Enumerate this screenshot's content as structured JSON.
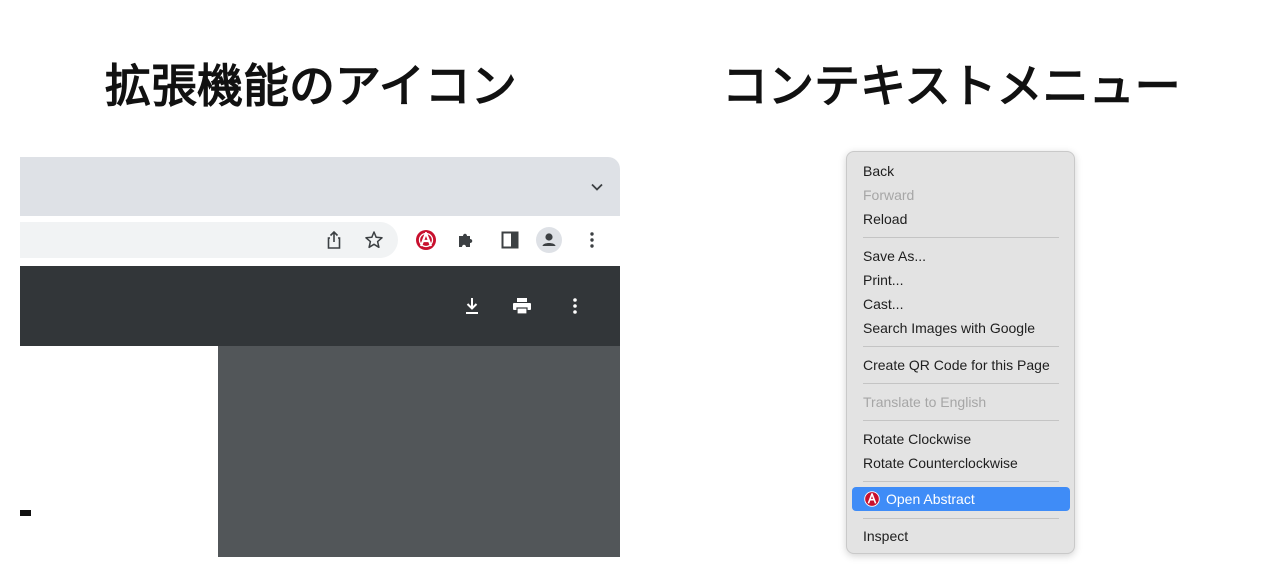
{
  "headings": {
    "left": "拡張機能のアイコン",
    "right": "コンテキストメニュー"
  },
  "browser": {
    "toolbar_icons": [
      "share-icon",
      "star-icon",
      "abstract-extension-icon",
      "puzzle-extensions-icon",
      "side-panel-icon",
      "profile-avatar-icon",
      "kebab-menu-icon"
    ],
    "pdf_toolbar_icons": [
      "download-icon",
      "print-icon",
      "more-icon"
    ],
    "colors": {
      "tabstrip": "#dee1e6",
      "pdf_toolbar": "#323639",
      "pdf_background": "#525659",
      "extension_red": "#c8102e"
    }
  },
  "context_menu": {
    "items": [
      {
        "label": "Back",
        "disabled": false
      },
      {
        "label": "Forward",
        "disabled": true
      },
      {
        "label": "Reload",
        "disabled": false
      },
      {
        "label": "Save As...",
        "disabled": false
      },
      {
        "label": "Print...",
        "disabled": false
      },
      {
        "label": "Cast...",
        "disabled": false
      },
      {
        "label": "Search Images with Google",
        "disabled": false
      },
      {
        "label": "Create QR Code for this Page",
        "disabled": false
      },
      {
        "label": "Translate to English",
        "disabled": true
      },
      {
        "label": "Rotate Clockwise",
        "disabled": false
      },
      {
        "label": "Rotate Counterclockwise",
        "disabled": false
      },
      {
        "label": "Open Abstract",
        "disabled": false,
        "highlighted": true,
        "icon": "abstract-logo-icon"
      },
      {
        "label": "Inspect",
        "disabled": false
      }
    ],
    "colors": {
      "highlight": "#3f8cf7",
      "background": "#e3e3e3"
    }
  }
}
